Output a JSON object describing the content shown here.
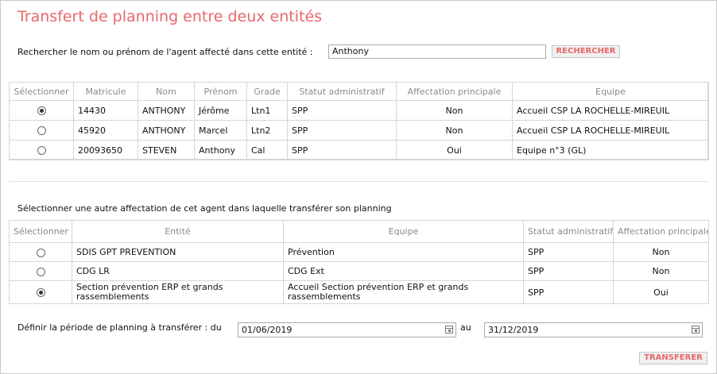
{
  "title": "Transfert de planning entre deux entités",
  "search": {
    "label": "Rechercher le nom ou prénom de l'agent affecté dans cette entité :",
    "value": "Anthony",
    "button": "RECHERCHER"
  },
  "agents_table": {
    "headers": [
      "Sélectionner",
      "Matricule",
      "Nom",
      "Prénom",
      "Grade",
      "Statut administratif",
      "Affectation principale",
      "Equipe"
    ],
    "rows": [
      {
        "selected": true,
        "matricule": "14430",
        "nom": "ANTHONY",
        "prenom": "Jérôme",
        "grade": "Ltn1",
        "statut": "SPP",
        "affectation": "Non",
        "equipe": "Accueil CSP LA ROCHELLE-MIREUIL"
      },
      {
        "selected": false,
        "matricule": "45920",
        "nom": "ANTHONY",
        "prenom": "Marcel",
        "grade": "Ltn2",
        "statut": "SPP",
        "affectation": "Non",
        "equipe": "Accueil CSP LA ROCHELLE-MIREUIL"
      },
      {
        "selected": false,
        "matricule": "20093650",
        "nom": "STEVEN",
        "prenom": "Anthony",
        "grade": "Cal",
        "statut": "SPP",
        "affectation": "Oui",
        "equipe": "Equipe n°3 (GL)"
      }
    ]
  },
  "affectation": {
    "label": "Sélectionner une autre affectation de cet agent dans laquelle transférer son planning",
    "headers": [
      "Sélectionner",
      "Entité",
      "Equipe",
      "Statut administratif",
      "Affectation principale"
    ],
    "rows": [
      {
        "selected": false,
        "entite": "SDIS GPT PREVENTION",
        "equipe": "Prévention",
        "statut": "SPP",
        "affectation": "Non"
      },
      {
        "selected": false,
        "entite": "CDG LR",
        "equipe": "CDG Ext",
        "statut": "SPP",
        "affectation": "Non"
      },
      {
        "selected": true,
        "entite": "Section prévention ERP et grands rassemblements",
        "equipe": "Accueil Section prévention ERP et grands rassemblements",
        "statut": "SPP",
        "affectation": "Oui"
      }
    ]
  },
  "period": {
    "label": "Définir la période de planning à transférer : du",
    "from": "01/06/2019",
    "to_label": "au",
    "to": "31/12/2019"
  },
  "transfer_button": "TRANSFERER"
}
